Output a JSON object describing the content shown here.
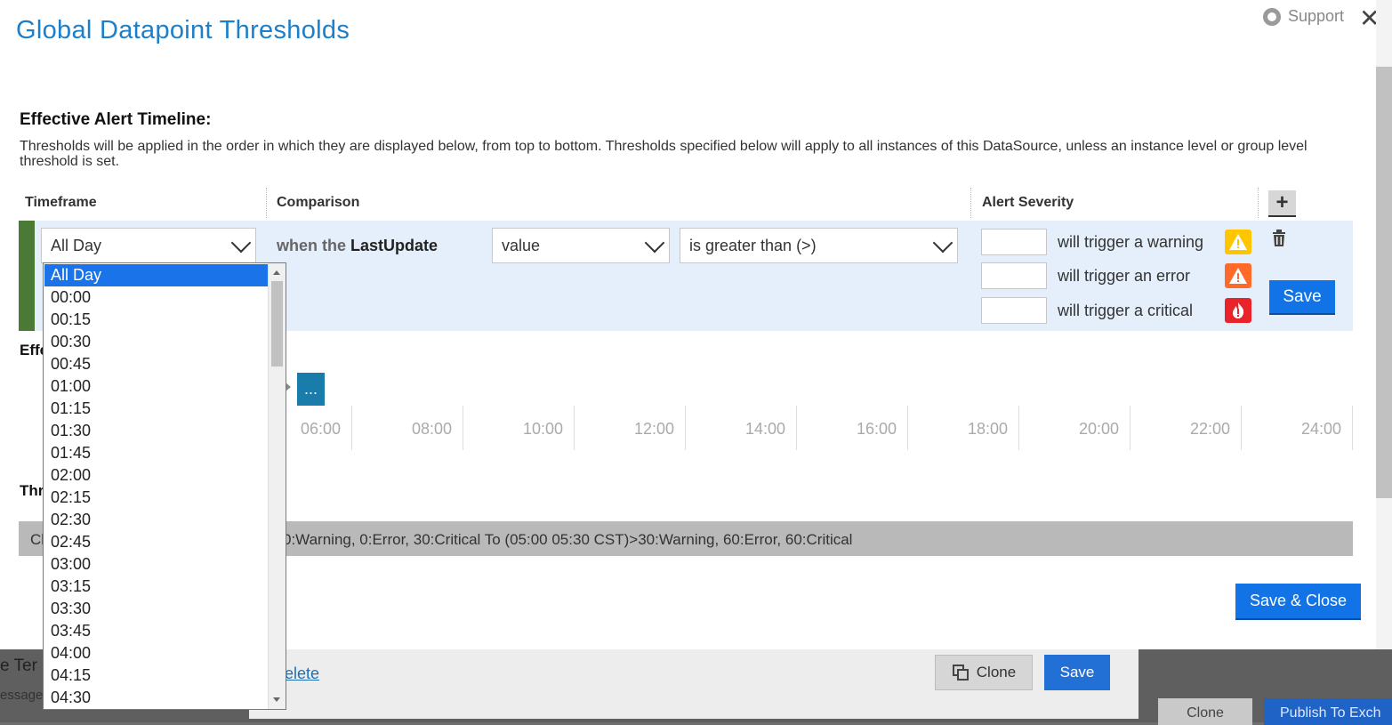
{
  "modal": {
    "title": "Global Datapoint Thresholds",
    "support_label": "Support",
    "close_glyph": "✕"
  },
  "section": {
    "title": "Effective Alert Timeline:",
    "description": "Thresholds will be applied in the order in which they are displayed below, from top to bottom. Thresholds specified below will apply to all instances of this DataSource, unless an instance level or group level threshold is set."
  },
  "columns": {
    "timeframe": "Timeframe",
    "comparison": "Comparison",
    "alert_severity": "Alert Severity",
    "add_glyph": "+"
  },
  "threshold_row": {
    "timeframe_value": "All Day",
    "when_prefix": "when the",
    "datapoint": "LastUpdate",
    "value_select": "value",
    "operator_select": "is greater than (>)",
    "warning_label": "will trigger a warning",
    "error_label": "will trigger an error",
    "critical_label": "will trigger a critical",
    "warning_value": "",
    "error_value": "",
    "critical_value": "",
    "save_label": "Save"
  },
  "timeline": {
    "label_partial": "Effe",
    "more_label": "...",
    "ticks": [
      "06:00",
      "08:00",
      "10:00",
      "12:00",
      "14:00",
      "16:00",
      "18:00",
      "20:00",
      "22:00",
      "24:00"
    ]
  },
  "thresholds_section": {
    "label_partial": "Thr",
    "summary_start": "Cl",
    "summary_text": "0:Warning, 0:Error, 30:Critical To (05:00 05:30 CST)>30:Warning, 60:Error, 60:Critical"
  },
  "footer": {
    "save_close_label": "Save & Close"
  },
  "dropdown": {
    "options": [
      "All Day",
      "00:00",
      "00:15",
      "00:30",
      "00:45",
      "01:00",
      "01:15",
      "01:30",
      "01:45",
      "02:00",
      "02:15",
      "02:30",
      "02:45",
      "03:00",
      "03:15",
      "03:30",
      "03:45",
      "04:00",
      "04:15",
      "04:30"
    ],
    "selected": "All Day"
  },
  "background": {
    "left_text": "e Ter",
    "left_subtext": "essage",
    "link": "elete",
    "clone_label": "Clone",
    "save_label": "Save",
    "clone2_label": "Clone",
    "publish_label": "Publish To Exch"
  },
  "colors": {
    "title_blue": "#1d7fc9",
    "primary_button": "#1273e6",
    "row_background": "#e4effb",
    "row_indicator": "#4b7a37",
    "warning": "#ffc600",
    "error": "#ff6a2a",
    "critical": "#e8232a",
    "timeline_more": "#1a7cab"
  }
}
